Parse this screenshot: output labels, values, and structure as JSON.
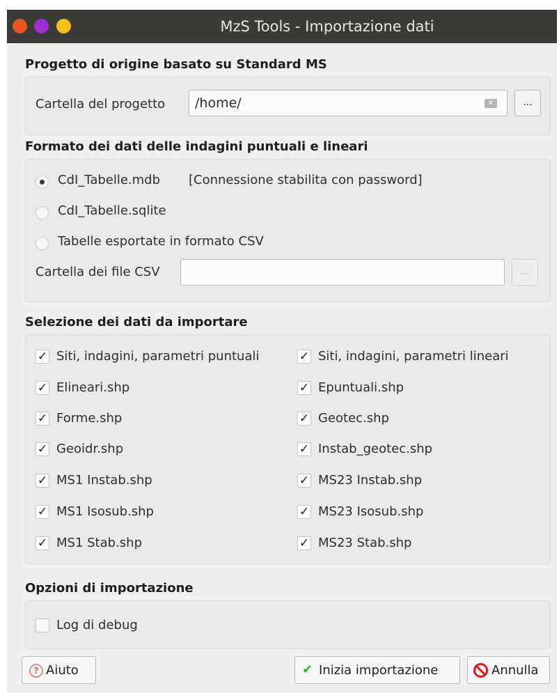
{
  "window": {
    "title": "MzS Tools - Importazione dati"
  },
  "origin_section": {
    "title": "Progetto di origine basato su Standard MS",
    "folder_label": "Cartella del progetto",
    "folder_value": "/home/",
    "browse_label": "..."
  },
  "format_section": {
    "title": "Formato dei dati delle indagini puntuali e lineari",
    "options": [
      {
        "label": "CdI_Tabelle.mdb",
        "checked": true
      },
      {
        "label": "CdI_Tabelle.sqlite",
        "checked": false
      },
      {
        "label": "Tabelle esportate in formato CSV",
        "checked": false
      }
    ],
    "connection_status": "[Connessione stabilita con password]",
    "csv_label": "Cartella dei file CSV",
    "csv_value": "",
    "browse_label": "..."
  },
  "selection_section": {
    "title": "Selezione dei dati da importare",
    "left": [
      "Siti, indagini, parametri puntuali",
      "Elineari.shp",
      "Forme.shp",
      "Geoidr.shp",
      "MS1 Instab.shp",
      "MS1 Isosub.shp",
      "MS1 Stab.shp"
    ],
    "right": [
      "Siti, indagini, parametri lineari",
      "Epuntuali.shp",
      "Geotec.shp",
      "Instab_geotec.shp",
      "MS23 Instab.shp",
      "MS23 Isosub.shp",
      "MS23 Stab.shp"
    ],
    "check_mark": "✓"
  },
  "options_section": {
    "title": "Opzioni di importazione",
    "debug_label": "Log di debug",
    "debug_checked": false
  },
  "buttons": {
    "help": "Aiuto",
    "start": "Inizia importazione",
    "cancel": "Annulla"
  },
  "icons": {
    "help": "help-circle-icon",
    "start": "checkmark-icon",
    "cancel": "no-entry-icon",
    "clear": "clear-text-icon"
  },
  "colors": {
    "titlebar": "#3c3b37",
    "close": "#e95420",
    "minimize": "#9b2fd6",
    "maximize": "#f5c211",
    "cancel_icon": "#d91d1d",
    "ok_icon": "#3dab3d"
  }
}
